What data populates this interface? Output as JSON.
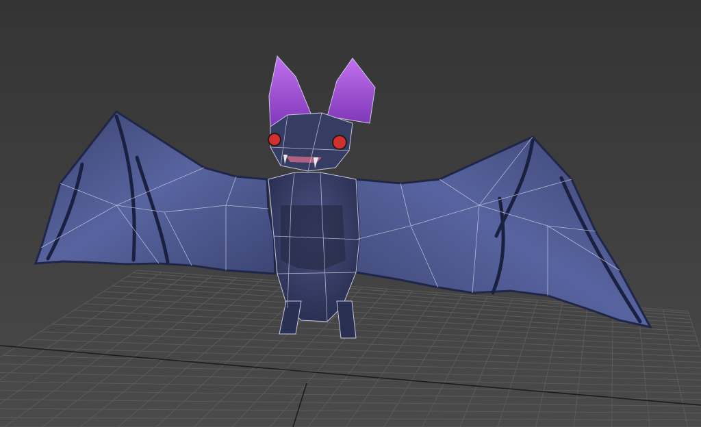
{
  "viewport": {
    "background_top": "#343434",
    "background_bottom": "#4a4a4a",
    "grid_color": "#5b5b5b",
    "axis_color": "#1c1c1c",
    "wire_color": "#c9c9e0"
  },
  "model": {
    "wing_fill": "#4d5788",
    "wing_edge": "#1f2647",
    "body_fill": "#363d63",
    "fur_dark": "#262b47",
    "ear_fill": "#a152d6",
    "eye_color": "#d03030",
    "teeth_color": "#e8e8e8"
  }
}
